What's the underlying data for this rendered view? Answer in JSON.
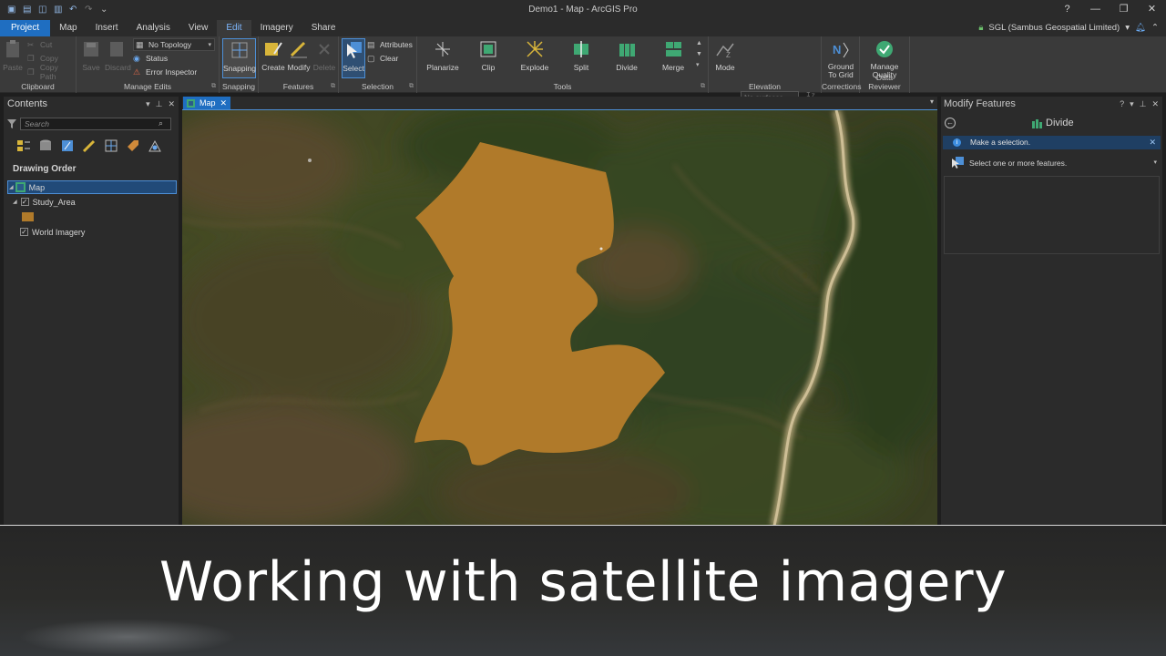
{
  "window": {
    "title": "Demo1 - Map - ArcGIS Pro",
    "help": "?",
    "minimize": "—",
    "restore": "❐",
    "close": "✕"
  },
  "tabs": [
    {
      "label": "Project"
    },
    {
      "label": "Map"
    },
    {
      "label": "Insert"
    },
    {
      "label": "Analysis"
    },
    {
      "label": "View"
    },
    {
      "label": "Edit"
    },
    {
      "label": "Imagery"
    },
    {
      "label": "Share"
    }
  ],
  "user": {
    "name": "SGL  (Sambus Geospatial Limited)"
  },
  "ribbon": {
    "clipboard": {
      "label": "Clipboard",
      "paste": "Paste",
      "cut": "Cut",
      "copy": "Copy",
      "copy_path": "Copy Path"
    },
    "manage_edits": {
      "label": "Manage Edits",
      "save": "Save",
      "discard": "Discard",
      "topology": "No Topology",
      "status": "Status",
      "error_inspector": "Error Inspector"
    },
    "snapping": {
      "label": "Snapping",
      "button": "Snapping"
    },
    "features": {
      "label": "Features",
      "create": "Create",
      "modify": "Modify",
      "delete": "Delete"
    },
    "selection": {
      "label": "Selection",
      "select": "Select",
      "attributes": "Attributes",
      "clear": "Clear"
    },
    "tools": {
      "label": "Tools",
      "planarize": "Planarize",
      "clip": "Clip",
      "explode": "Explode",
      "split": "Split",
      "divide": "Divide",
      "merge": "Merge"
    },
    "elevation": {
      "label": "Elevation",
      "mode": "Mode",
      "surface_placeholder": "No surfaces"
    },
    "corrections": {
      "label": "Corrections",
      "ground_to_grid": "Ground To Grid"
    },
    "data_reviewer": {
      "label": "Data Reviewer",
      "manage_quality": "Manage Quality"
    }
  },
  "contents": {
    "title": "Contents",
    "search_placeholder": "Search",
    "drawing_order": "Drawing Order",
    "layers": [
      {
        "name": "Map"
      },
      {
        "name": "Study_Area"
      },
      {
        "name": "World Imagery"
      }
    ],
    "study_area_color": "#b07a2a"
  },
  "map": {
    "tab_label": "Map",
    "polygon_color": "#b07a2a"
  },
  "modify": {
    "title": "Modify Features",
    "tool": "Divide",
    "message": "Make a selection.",
    "prompt": "Select one or more features."
  },
  "caption": {
    "text": "Working with satellite imagery"
  }
}
